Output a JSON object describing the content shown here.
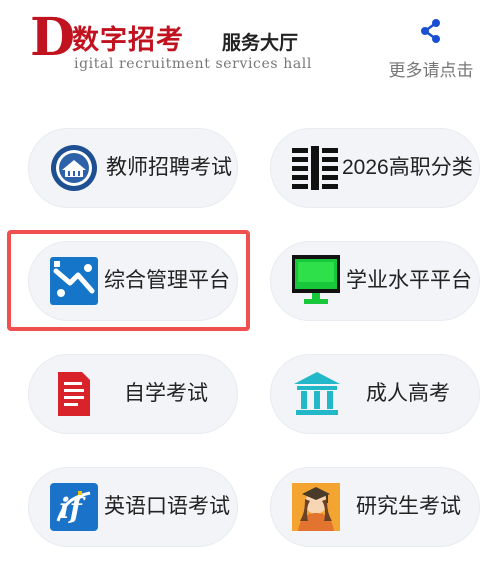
{
  "header": {
    "logo_letter": "D",
    "logo_title": "数字招考",
    "logo_side": "服务大厅",
    "logo_subtitle": "igital recruitment services hall",
    "share_label": "更多请点击"
  },
  "services": [
    {
      "label": "教师招聘考试",
      "icon": "seal-icon"
    },
    {
      "label": "2026高职分类",
      "icon": "book-icon"
    },
    {
      "label": "综合管理平台",
      "icon": "platform-icon"
    },
    {
      "label": "学业水平平台",
      "icon": "monitor-icon"
    },
    {
      "label": "自学考试",
      "icon": "document-icon"
    },
    {
      "label": "成人高考",
      "icon": "building-icon"
    },
    {
      "label": "英语口语考试",
      "icon": "speech-icon"
    },
    {
      "label": "研究生考试",
      "icon": "graduate-icon"
    }
  ],
  "highlighted_item": "综合管理平台",
  "colors": {
    "brand_red": "#c1121f",
    "share_blue": "#1b4fd1",
    "highlight": "#ef4f4f",
    "button_bg": "#f2f4f7"
  }
}
